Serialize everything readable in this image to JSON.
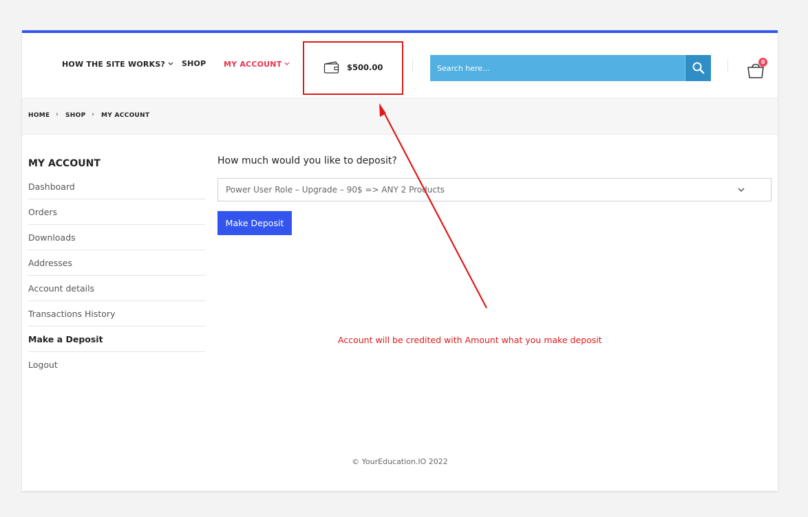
{
  "nav": {
    "items": [
      {
        "label": "HOW THE SITE WORKS?",
        "has_dropdown": true
      },
      {
        "label": "SHOP",
        "has_dropdown": false
      },
      {
        "label": "MY ACCOUNT",
        "has_dropdown": true
      }
    ],
    "active_color": "#e8334f",
    "accent_color": "#3355ee"
  },
  "wallet": {
    "icon": "wallet-icon",
    "amount": "$500.00",
    "highlight_color": "#e01818"
  },
  "search": {
    "placeholder": "Search here...",
    "icon": "search-icon"
  },
  "cart": {
    "icon": "shopping-bag-icon",
    "count": "0"
  },
  "breadcrumb": {
    "items": [
      "HOME",
      "SHOP",
      "MY ACCOUNT"
    ]
  },
  "sidebar": {
    "title": "MY ACCOUNT",
    "items": [
      {
        "label": "Dashboard"
      },
      {
        "label": "Orders"
      },
      {
        "label": "Downloads"
      },
      {
        "label": "Addresses"
      },
      {
        "label": "Account details"
      },
      {
        "label": "Transactions History"
      },
      {
        "label": "Make a Deposit",
        "active": true
      },
      {
        "label": "Logout"
      }
    ]
  },
  "deposit": {
    "question": "How much would you like to deposit?",
    "selected_option": "Power User Role – Upgrade – 90$ => ANY 2 Products",
    "button_label": "Make Deposit"
  },
  "annotation": {
    "note": "Account will be credited with Amount what you make deposit"
  },
  "footer": {
    "copyright": "© YourEducation.IO 2022"
  }
}
